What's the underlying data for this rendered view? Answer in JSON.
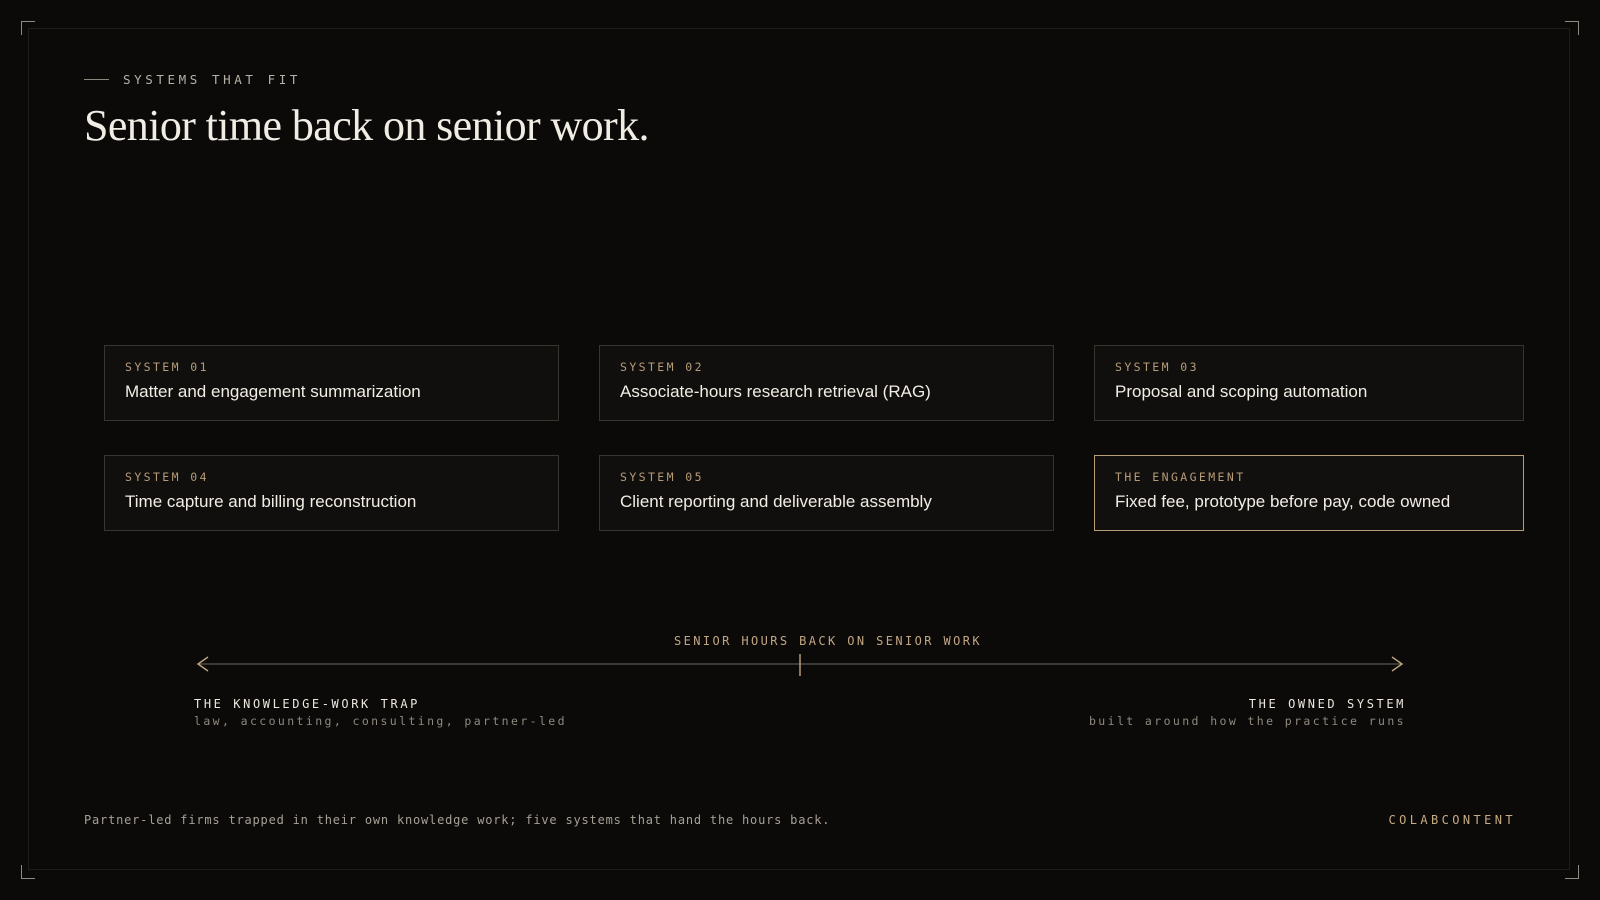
{
  "eyebrow": "SYSTEMS THAT FIT",
  "headline": "Senior time back on senior work.",
  "cards": [
    {
      "label": "SYSTEM 01",
      "title": "Matter and engagement summarization"
    },
    {
      "label": "SYSTEM 02",
      "title": "Associate-hours research retrieval (RAG)"
    },
    {
      "label": "SYSTEM 03",
      "title": "Proposal and scoping automation"
    },
    {
      "label": "SYSTEM 04",
      "title": "Time capture and billing reconstruction"
    },
    {
      "label": "SYSTEM 05",
      "title": "Client reporting and deliverable assembly"
    },
    {
      "label": "THE ENGAGEMENT",
      "title": "Fixed fee, prototype before pay, code owned"
    }
  ],
  "axis": {
    "caption": "SENIOR HOURS BACK ON SENIOR WORK",
    "left": {
      "title": "THE KNOWLEDGE-WORK TRAP",
      "subtitle": "law, accounting, consulting, partner-led"
    },
    "right": {
      "title": "THE OWNED SYSTEM",
      "subtitle": "built around how the practice runs"
    }
  },
  "footer": {
    "note": "Partner-led firms trapped in their own knowledge work; five systems that hand the hours back.",
    "brand": "COLABCONTENT"
  },
  "colors": {
    "background": "#0b0a09",
    "accent": "#c1a684",
    "highlight_border": "#b89f78"
  }
}
